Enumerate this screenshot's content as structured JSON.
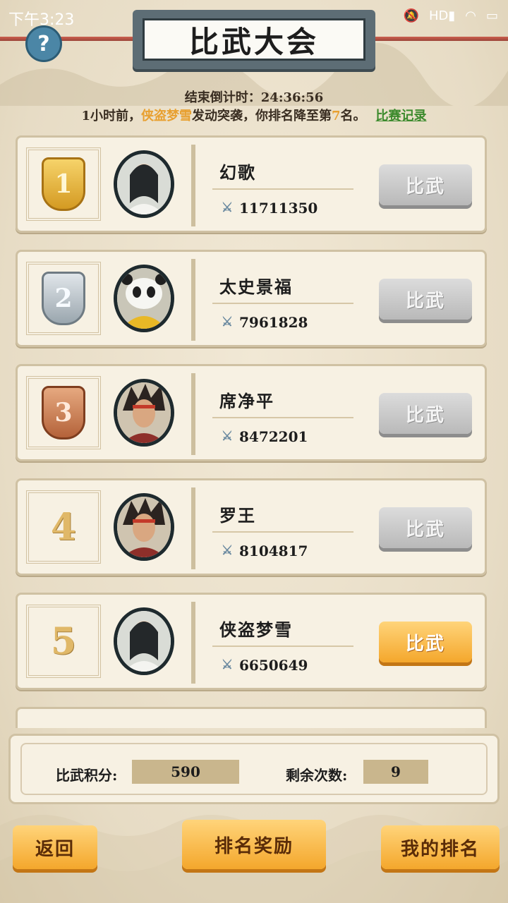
{
  "status_bar": {
    "time": "下午3:23",
    "network": "HD"
  },
  "header": {
    "title": "比武大会",
    "help_label": "?"
  },
  "countdown": {
    "text": "结束倒计时：24:36:56"
  },
  "notice": {
    "prefix": "1小时前，",
    "attacker": "侠盗梦雪",
    "middle": "发动突袭，你排名降至第",
    "rank": "7",
    "suffix": "名。",
    "record_link": "比赛记录"
  },
  "players": [
    {
      "rank": "1",
      "medal": "gold",
      "name": "幻歌",
      "power": "11711350",
      "button": "比武",
      "button_style": "gray"
    },
    {
      "rank": "2",
      "medal": "silver",
      "name": "太史景福",
      "power": "7961828",
      "button": "比武",
      "button_style": "gray"
    },
    {
      "rank": "3",
      "medal": "bronze",
      "name": "席净平",
      "power": "8472201",
      "button": "比武",
      "button_style": "gray"
    },
    {
      "rank": "4",
      "medal": "",
      "name": "罗王",
      "power": "8104817",
      "button": "比武",
      "button_style": "gray"
    },
    {
      "rank": "5",
      "medal": "",
      "name": "侠盗梦雪",
      "power": "6650649",
      "button": "比武",
      "button_style": "gold"
    }
  ],
  "summary": {
    "points_label": "比武积分:",
    "points_value": "590",
    "remaining_label": "剩余次数:",
    "remaining_value": "9"
  },
  "buttons": {
    "back": "返回",
    "rank_reward": "排名奖励",
    "my_rank": "我的排名"
  },
  "colors": {
    "accent_gold": "#f4a72c",
    "highlight": "#e8a030",
    "link_green": "#3b8a2c"
  }
}
